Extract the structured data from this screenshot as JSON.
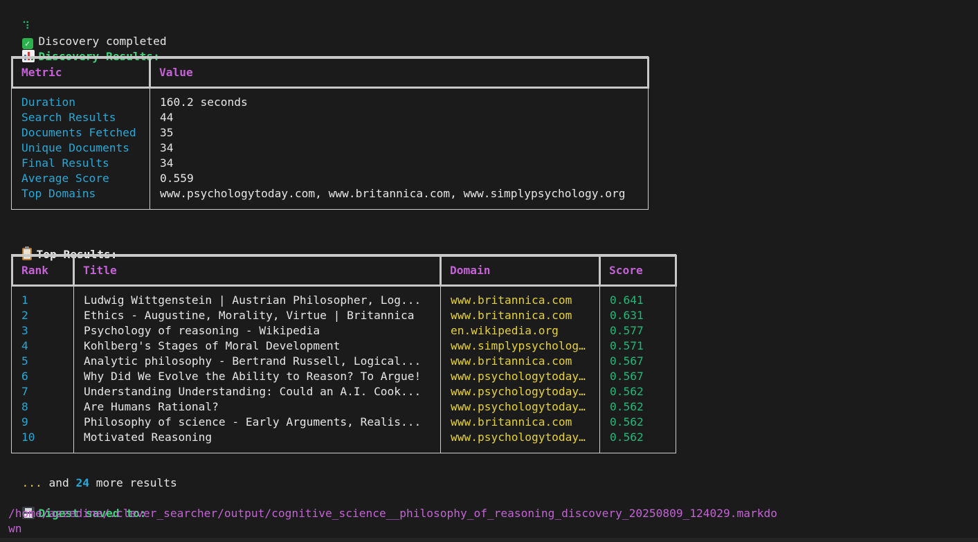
{
  "status_line": {
    "spinner": "⠹",
    "text": "Discovery completed"
  },
  "discovery": {
    "heading": "Discovery Results:",
    "headers": {
      "metric": "Metric",
      "value": "Value"
    },
    "rows": [
      {
        "metric": "Duration",
        "value": "160.2 seconds"
      },
      {
        "metric": "Search Results",
        "value": "44"
      },
      {
        "metric": "Documents Fetched",
        "value": "35"
      },
      {
        "metric": "Unique Documents",
        "value": "34"
      },
      {
        "metric": "Final Results",
        "value": "34"
      },
      {
        "metric": "Average Score",
        "value": "0.559"
      },
      {
        "metric": "Top Domains",
        "value": "www.psychologytoday.com, www.britannica.com, www.simplypsychology.org"
      }
    ]
  },
  "top_results": {
    "heading": "Top Results:",
    "headers": {
      "rank": "Rank",
      "title": "Title",
      "domain": "Domain",
      "score": "Score"
    },
    "rows": [
      {
        "rank": "1",
        "title": "Ludwig Wittgenstein | Austrian Philosopher, Log...",
        "domain": "www.britannica.com",
        "score": "0.641"
      },
      {
        "rank": "2",
        "title": "Ethics - Augustine, Morality, Virtue | Britannica",
        "domain": "www.britannica.com",
        "score": "0.631"
      },
      {
        "rank": "3",
        "title": "Psychology of reasoning - Wikipedia",
        "domain": "en.wikipedia.org",
        "score": "0.577"
      },
      {
        "rank": "4",
        "title": "Kohlberg's Stages of Moral Development",
        "domain": "www.simplypsycholog…",
        "score": "0.571"
      },
      {
        "rank": "5",
        "title": "Analytic philosophy - Bertrand Russell, Logical...",
        "domain": "www.britannica.com",
        "score": "0.567"
      },
      {
        "rank": "6",
        "title": "Why Did We Evolve the Ability to Reason? To Argue!",
        "domain": "www.psychologytoday…",
        "score": "0.567"
      },
      {
        "rank": "7",
        "title": "Understanding Understanding: Could an A.I. Cook...",
        "domain": "www.psychologytoday…",
        "score": "0.562"
      },
      {
        "rank": "8",
        "title": "Are Humans Rational?",
        "domain": "www.psychologytoday…",
        "score": "0.562"
      },
      {
        "rank": "9",
        "title": "Philosophy of science - Early Arguments, Realis...",
        "domain": "www.britannica.com",
        "score": "0.562"
      },
      {
        "rank": "10",
        "title": "Motivated Reasoning",
        "domain": "www.psychologytoday…",
        "score": "0.562"
      }
    ]
  },
  "more": {
    "ellipsis": "...",
    "and": "and",
    "count": "24",
    "tail": "more results"
  },
  "digest": {
    "heading": "Digest saved to:",
    "path_line1": "/home/azzedine/.clever_searcher/output/cognitive_science__philosophy_of_reasoning_discovery_20250809_124029.markdo",
    "path_line2": "wn"
  },
  "icons": {
    "status": "check-mark-icon",
    "discovery": "bar-chart-icon",
    "top_results": "clipboard-icon",
    "digest": "floppy-disk-icon"
  },
  "colors": {
    "background": "#1b1b1b",
    "header": "#c462d6",
    "metric": "#27a9d8",
    "domain": "#e5d23a",
    "score": "#1fb979",
    "heading": "#3ed17a"
  }
}
